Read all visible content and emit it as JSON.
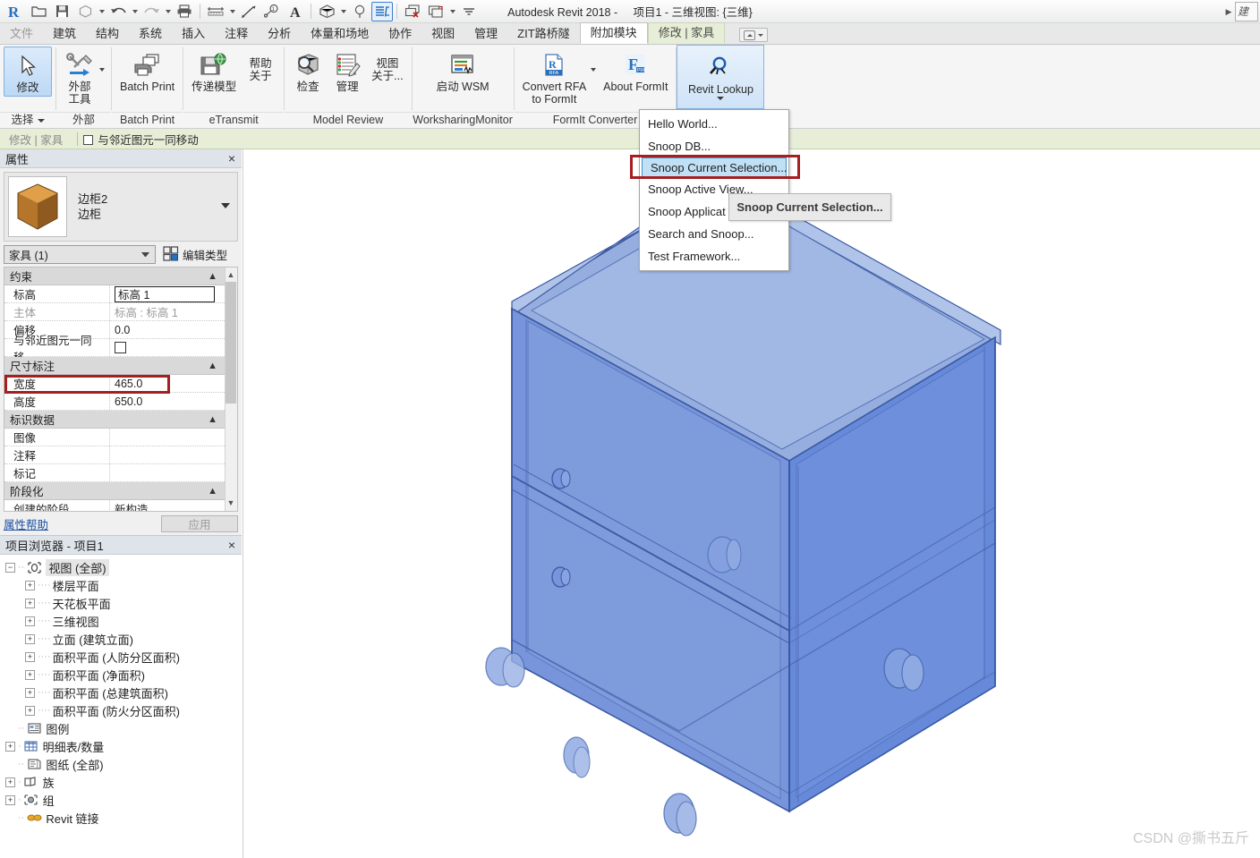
{
  "titlebar": {
    "app_title": "Autodesk Revit 2018 -",
    "doc_title": "项目1 - 三维视图: {三维}",
    "quick_access": [
      {
        "name": "revit-logo",
        "label": "R"
      },
      {
        "name": "open-icon",
        "label": "Open"
      },
      {
        "name": "save-icon",
        "label": "Save"
      },
      {
        "name": "save-as-icon",
        "label": "Save As"
      },
      {
        "name": "undo-icon",
        "label": "Undo"
      },
      {
        "name": "redo-icon",
        "label": "Redo"
      },
      {
        "name": "print-icon",
        "label": "Print"
      },
      {
        "name": "measure-icon",
        "label": "Measure"
      },
      {
        "name": "aligned-dimension-icon",
        "label": "Aligned Dimension"
      },
      {
        "name": "tag-icon",
        "label": "Tag"
      },
      {
        "name": "text-icon",
        "label": "Text"
      },
      {
        "name": "default-3d-view-icon",
        "label": "Default 3D View"
      },
      {
        "name": "section-icon",
        "label": "Section"
      },
      {
        "name": "thin-lines-icon",
        "label": "Thin Lines"
      },
      {
        "name": "close-hidden-windows-icon",
        "label": "Close Hidden Windows"
      },
      {
        "name": "switch-windows-icon",
        "label": "Switch Windows"
      },
      {
        "name": "customize-qat-icon",
        "label": "Customize"
      }
    ],
    "right_field_text": "建入"
  },
  "tabs": [
    {
      "label": "文件",
      "state": "file"
    },
    {
      "label": "建筑",
      "state": "normal"
    },
    {
      "label": "结构",
      "state": "normal"
    },
    {
      "label": "系统",
      "state": "normal"
    },
    {
      "label": "插入",
      "state": "normal"
    },
    {
      "label": "注释",
      "state": "normal"
    },
    {
      "label": "分析",
      "state": "normal"
    },
    {
      "label": "体量和场地",
      "state": "normal"
    },
    {
      "label": "协作",
      "state": "normal"
    },
    {
      "label": "视图",
      "state": "normal"
    },
    {
      "label": "管理",
      "state": "normal"
    },
    {
      "label": "ZIT路桥隧",
      "state": "normal"
    },
    {
      "label": "附加模块",
      "state": "active"
    },
    {
      "label": "修改 | 家具",
      "state": "contextual"
    }
  ],
  "ribbon": {
    "panels": [
      {
        "title": "选择",
        "has_title_caret": true,
        "buttons": [
          {
            "name": "modify-button",
            "label": "修改",
            "icon": "cursor-arrow-icon",
            "state": "selected"
          }
        ]
      },
      {
        "title": "外部",
        "has_title_caret": false,
        "buttons": [
          {
            "name": "external-tools-button",
            "label": "外部\n工具",
            "icon": "wrench-hammer-icon",
            "state": "normal",
            "caret": true
          }
        ]
      },
      {
        "title": "Batch Print",
        "has_title_caret": false,
        "buttons": [
          {
            "name": "batch-print-button",
            "label": "Batch Print",
            "icon": "printer-icon",
            "state": "normal"
          }
        ]
      },
      {
        "title": "eTransmit",
        "has_title_caret": false,
        "buttons": [
          {
            "name": "transmit-model-button",
            "label": "传递模型",
            "icon": "floppy-globe-icon",
            "state": "normal"
          },
          {
            "name": "etransmit-help-button",
            "label": "帮助\n关于",
            "icon": "text-only-icon",
            "state": "normal"
          }
        ]
      },
      {
        "title": "Model Review",
        "has_title_caret": false,
        "buttons": [
          {
            "name": "model-check-button",
            "label": "检查",
            "icon": "magnifier-box-icon",
            "state": "normal"
          },
          {
            "name": "model-manage-button",
            "label": "管理",
            "icon": "checklist-pencil-icon",
            "state": "normal"
          },
          {
            "name": "model-view-about-button",
            "label": "视图\n关于...",
            "icon": "text-only-icon",
            "state": "normal"
          }
        ]
      },
      {
        "title": "WorksharingMonitor",
        "has_title_caret": false,
        "buttons": [
          {
            "name": "start-wsm-button",
            "label": "启动 WSM",
            "icon": "monitor-chart-icon",
            "state": "normal"
          }
        ]
      },
      {
        "title": "FormIt Converter",
        "has_title_caret": false,
        "buttons": [
          {
            "name": "convert-rfa-to-formit-button",
            "label": "Convert RFA\nto FormIt",
            "icon": "rfa-file-icon",
            "state": "normal",
            "caret": true
          },
          {
            "name": "about-formit-button",
            "label": "About FormIt",
            "icon": "formit-pro-icon",
            "state": "normal"
          }
        ]
      },
      {
        "title": "",
        "has_title_caret": false,
        "buttons": [
          {
            "name": "revit-lookup-button",
            "label": "Revit Lookup",
            "icon": "lookup-magnifier-icon",
            "state": "selbox",
            "caret_below": true
          }
        ]
      }
    ]
  },
  "lookup_menu": {
    "items": [
      {
        "label": "Hello World...",
        "active": false
      },
      {
        "label": "Snoop DB...",
        "active": false
      },
      {
        "label": "Snoop Current Selection...",
        "active": true
      },
      {
        "label": "Snoop Active View...",
        "active": false
      },
      {
        "label": "Snoop Applicat",
        "active": false
      },
      {
        "label": "Search and Snoop...",
        "active": false
      },
      {
        "label": "Test Framework...",
        "active": false
      }
    ],
    "tooltip": "Snoop Current Selection...",
    "highlight_color": "#a41f1f"
  },
  "options_bar": {
    "context_label": "修改 | 家具",
    "checkbox_label": "与邻近图元一同移动",
    "checked": false
  },
  "properties": {
    "panel_title": "属性",
    "close_label": "×",
    "family_name": "边柜2",
    "type_name": "边柜",
    "category_selector": "家具 (1)",
    "edit_type_label": "编辑类型",
    "groups": [
      {
        "name": "约束",
        "rows": [
          {
            "key": "标高",
            "value": "标高 1",
            "style": "boxed"
          },
          {
            "key": "主体",
            "value": "标高 : 标高 1",
            "style": "dim"
          },
          {
            "key": "偏移",
            "value": "0.0",
            "style": "plain"
          },
          {
            "key": "与邻近图元一同移...",
            "value": "",
            "style": "checkbox"
          }
        ]
      },
      {
        "name": "尺寸标注",
        "rows": [
          {
            "key": "宽度",
            "value": "465.0",
            "style": "highlight"
          },
          {
            "key": "高度",
            "value": "650.0",
            "style": "plain"
          }
        ]
      },
      {
        "name": "标识数据",
        "rows": [
          {
            "key": "图像",
            "value": "",
            "style": "plain"
          },
          {
            "key": "注释",
            "value": "",
            "style": "plain"
          },
          {
            "key": "标记",
            "value": "",
            "style": "plain"
          }
        ]
      },
      {
        "name": "阶段化",
        "rows": [
          {
            "key": "创建的阶段",
            "value": "新构造",
            "style": "plain"
          }
        ]
      }
    ],
    "help_link": "属性帮助",
    "apply_button": "应用"
  },
  "project_browser": {
    "panel_title": "项目浏览器 - 项目1",
    "close_label": "×",
    "nodes": [
      {
        "label": "视图 (全部)",
        "depth": 0,
        "expander": "-",
        "icon": "views-icon",
        "selected": true
      },
      {
        "label": "楼层平面",
        "depth": 1,
        "expander": "+",
        "icon": "none",
        "selected": false
      },
      {
        "label": "天花板平面",
        "depth": 1,
        "expander": "+",
        "icon": "none",
        "selected": false
      },
      {
        "label": "三维视图",
        "depth": 1,
        "expander": "+",
        "icon": "none",
        "selected": false
      },
      {
        "label": "立面 (建筑立面)",
        "depth": 1,
        "expander": "+",
        "icon": "none",
        "selected": false
      },
      {
        "label": "面积平面 (人防分区面积)",
        "depth": 1,
        "expander": "+",
        "icon": "none",
        "selected": false
      },
      {
        "label": "面积平面 (净面积)",
        "depth": 1,
        "expander": "+",
        "icon": "none",
        "selected": false
      },
      {
        "label": "面积平面 (总建筑面积)",
        "depth": 1,
        "expander": "+",
        "icon": "none",
        "selected": false
      },
      {
        "label": "面积平面 (防火分区面积)",
        "depth": 1,
        "expander": "+",
        "icon": "none",
        "selected": false
      },
      {
        "label": "图例",
        "depth": 0,
        "expander": "none",
        "icon": "legend-icon",
        "selected": false
      },
      {
        "label": "明细表/数量",
        "depth": 0,
        "expander": "+",
        "icon": "schedule-icon",
        "selected": false
      },
      {
        "label": "图纸 (全部)",
        "depth": 0,
        "expander": "none",
        "icon": "sheet-icon",
        "selected": false
      },
      {
        "label": "族",
        "depth": 0,
        "expander": "+",
        "icon": "family-icon",
        "selected": false
      },
      {
        "label": "组",
        "depth": 0,
        "expander": "+",
        "icon": "group-icon",
        "selected": false
      },
      {
        "label": "Revit 链接",
        "depth": 0,
        "expander": "none",
        "icon": "link-icon",
        "selected": false
      }
    ]
  },
  "canvas": {
    "watermark": "CSDN @撕书五斤",
    "model_name": "边柜2",
    "selection_color": "#5a80d6",
    "background": "#ffffff"
  }
}
